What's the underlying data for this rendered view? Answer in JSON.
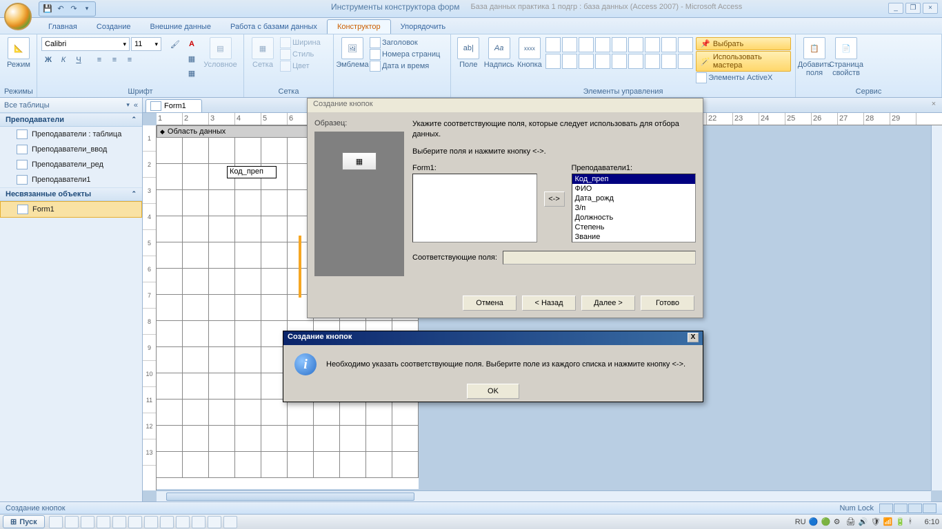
{
  "title": {
    "context": "Инструменты конструктора форм",
    "db": "База данных практика 1 подгр : база данных (Access 2007) - Microsoft Access"
  },
  "tabs": {
    "items": [
      "Главная",
      "Создание",
      "Внешние данные",
      "Работа с базами данных",
      "Конструктор",
      "Упорядочить"
    ],
    "active": "Конструктор"
  },
  "ribbon": {
    "mode": {
      "btn": "Режим",
      "group": "Режимы"
    },
    "font": {
      "name": "Calibri",
      "size": "11",
      "bold": "Ж",
      "italic": "К",
      "under": "Ч",
      "cond": "Условное",
      "group": "Шрифт"
    },
    "grid": {
      "btn": "Сетка",
      "width": "Ширина",
      "style": "Стиль",
      "color": "Цвет",
      "group": "Сетка"
    },
    "logo": {
      "btn": "Эмблема"
    },
    "header": {
      "title": "Заголовок",
      "pages": "Номера страниц",
      "datetime": "Дата и время"
    },
    "controls": {
      "field": "Поле",
      "label": "Надпись",
      "button": "Кнопка",
      "select": "Выбрать",
      "wizard": "Использовать мастера",
      "activex": "Элементы ActiveX",
      "group": "Элементы управления"
    },
    "tools": {
      "addfields": "Добавить поля",
      "propsheet": "Страница свойств",
      "group": "Сервис"
    }
  },
  "nav": {
    "header": "Все таблицы",
    "group1": "Преподаватели",
    "items1": [
      "Преподаватели : таблица",
      "Преподаватели_ввод",
      "Преподаватели_ред",
      "Преподаватели1"
    ],
    "group2": "Несвязанные объекты",
    "items2": [
      "Form1"
    ]
  },
  "doc": {
    "tab": "Form1",
    "section": "Область данных",
    "field_label": "Код_преп",
    "ruler_v": [
      "1",
      "2",
      "3",
      "4",
      "5",
      "6",
      "7",
      "8",
      "9",
      "10",
      "11",
      "12",
      "13"
    ]
  },
  "wizard": {
    "title": "Создание кнопок",
    "sample": "Образец:",
    "instruction": "Укажите соответствующие поля, которые следует использовать для отбора данных.",
    "hint": "Выберите поля и нажмите кнопку <->.",
    "left_label": "Form1:",
    "right_label": "Преподаватели1:",
    "right_items": [
      "Код_преп",
      "ФИО",
      "Дата_рожд",
      "З/п",
      "Должность",
      "Степень",
      "Звание"
    ],
    "move": "<->",
    "match_label": "Соответствующие поля:",
    "btn_cancel": "Отмена",
    "btn_back": "< Назад",
    "btn_next": "Далее >",
    "btn_finish": "Готово"
  },
  "alert": {
    "title": "Создание кнопок",
    "text": "Необходимо указать соответствующие поля. Выберите поле из каждого списка и нажмите кнопку <->.",
    "ok": "OK"
  },
  "status": {
    "text": "Создание кнопок",
    "numlock": "Num Lock"
  },
  "taskbar": {
    "start": "Пуск",
    "lang": "RU",
    "time": "6:10"
  }
}
